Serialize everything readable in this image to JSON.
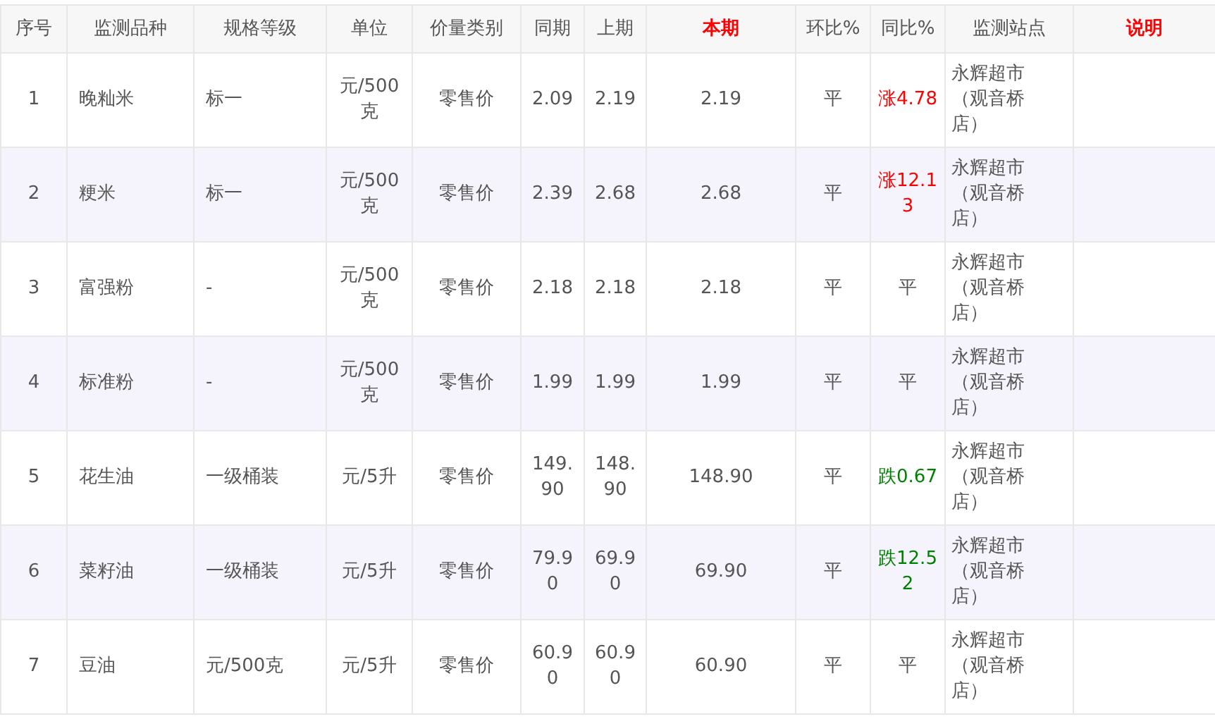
{
  "table": {
    "columns": [
      {
        "label": "序号",
        "highlight": false
      },
      {
        "label": "监测品种",
        "highlight": false
      },
      {
        "label": "规格等级",
        "highlight": false
      },
      {
        "label": "单位",
        "highlight": false
      },
      {
        "label": "价量类别",
        "highlight": false
      },
      {
        "label": "同期",
        "highlight": false
      },
      {
        "label": "上期",
        "highlight": false
      },
      {
        "label": "本期",
        "highlight": true
      },
      {
        "label": "环比%",
        "highlight": false
      },
      {
        "label": "同比%",
        "highlight": false
      },
      {
        "label": "监测站点",
        "highlight": false
      },
      {
        "label": "说明",
        "highlight": true
      }
    ],
    "rows": [
      {
        "no": "1",
        "item": "晚籼米",
        "grade": "标一",
        "unit": "元/500克",
        "price_type": "零售价",
        "same_period": "2.09",
        "last_period": "2.19",
        "current": "2.19",
        "mom": "平",
        "yoy": {
          "text": "涨4.78",
          "kind": "up"
        },
        "station": "永辉超市（观音桥店）"
      },
      {
        "no": "2",
        "item": "粳米",
        "grade": "标一",
        "unit": "元/500克",
        "price_type": "零售价",
        "same_period": "2.39",
        "last_period": "2.68",
        "current": "2.68",
        "mom": "平",
        "yoy": {
          "text": "涨12.13",
          "kind": "up"
        },
        "station": "永辉超市（观音桥店）"
      },
      {
        "no": "3",
        "item": "富强粉",
        "grade": "-",
        "unit": "元/500克",
        "price_type": "零售价",
        "same_period": "2.18",
        "last_period": "2.18",
        "current": "2.18",
        "mom": "平",
        "yoy": {
          "text": "平",
          "kind": "flat"
        },
        "station": "永辉超市（观音桥店）"
      },
      {
        "no": "4",
        "item": "标准粉",
        "grade": "-",
        "unit": "元/500克",
        "price_type": "零售价",
        "same_period": "1.99",
        "last_period": "1.99",
        "current": "1.99",
        "mom": "平",
        "yoy": {
          "text": "平",
          "kind": "flat"
        },
        "station": "永辉超市（观音桥店）"
      },
      {
        "no": "5",
        "item": "花生油",
        "grade": "一级桶装",
        "unit": "元/5升",
        "price_type": "零售价",
        "same_period": "149.90",
        "last_period": "148.90",
        "current": "148.90",
        "mom": "平",
        "yoy": {
          "text": "跌0.67",
          "kind": "down"
        },
        "station": "永辉超市（观音桥店）"
      },
      {
        "no": "6",
        "item": "菜籽油",
        "grade": "一级桶装",
        "unit": "元/5升",
        "price_type": "零售价",
        "same_period": "79.90",
        "last_period": "69.90",
        "current": "69.90",
        "mom": "平",
        "yoy": {
          "text": "跌12.52",
          "kind": "down"
        },
        "station": "永辉超市（观音桥店）"
      },
      {
        "no": "7",
        "item": "豆油",
        "grade": "元/500克",
        "unit": "元/5升",
        "price_type": "零售价",
        "same_period": "60.90",
        "last_period": "60.90",
        "current": "60.90",
        "mom": "平",
        "yoy": {
          "text": "平",
          "kind": "flat"
        },
        "station": "永辉超市（观音桥店）"
      }
    ]
  }
}
